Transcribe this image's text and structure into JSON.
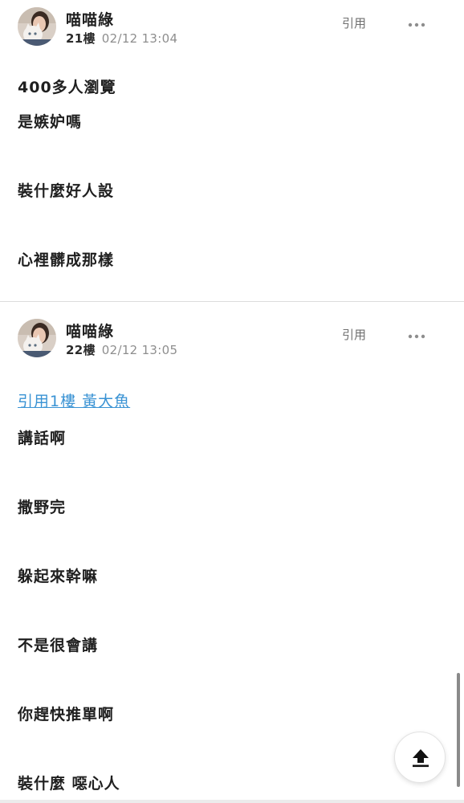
{
  "posts": [
    {
      "username": "喵喵綠",
      "floor": "21樓",
      "timestamp": "02/12 13:04",
      "quote_label": "引用",
      "more_icon": "more-horizontal-icon",
      "lines": [
        "400多人瀏覽",
        "是嫉妒嗎",
        "裝什麼好人設",
        "心裡髒成那樣"
      ]
    },
    {
      "username": "喵喵綠",
      "floor": "22樓",
      "timestamp": "02/12 13:05",
      "quote_label": "引用",
      "more_icon": "more-horizontal-icon",
      "quote_ref": "引用1樓 黃大魚",
      "lines": [
        "講話啊",
        "撒野完",
        "躲起來幹嘛",
        "不是很會講",
        "你趕快推單啊",
        "裝什麼 噁心人"
      ]
    }
  ],
  "scroll_top_icon": "arrow-up-to-line-icon",
  "colors": {
    "link": "#3a93d4",
    "text": "#1f1f1f",
    "meta": "#8e8e8e"
  }
}
